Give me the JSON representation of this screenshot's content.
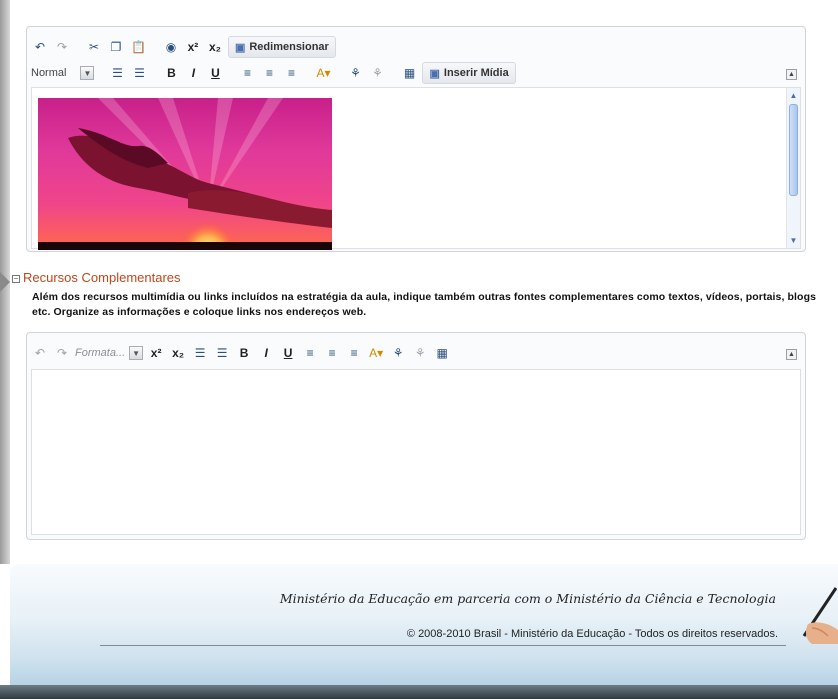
{
  "editor_top": {
    "toolbar_row1": {
      "resize_label": "Redimensionar"
    },
    "toolbar_row2": {
      "format_value": "Normal",
      "bold": "B",
      "italic": "I",
      "underline": "U",
      "insert_media_label": "Inserir Mídia"
    }
  },
  "section": {
    "title": "Recursos Complementares",
    "description": "Além dos recursos multimídia ou links incluídos na estratégia da aula, indique também outras fontes complementares como textos, vídeos, portais, blogs etc. Organize as informações e coloque links nos endereços web."
  },
  "editor_bottom": {
    "toolbar": {
      "format_placeholder": "Formata...",
      "bold": "B",
      "italic": "I",
      "underline": "U"
    }
  },
  "footer": {
    "tagline": "Ministério da Educação em parceria com o Ministério da Ciência e Tecnologia",
    "copyright": "© 2008-2010 Brasil - Ministério da Educação - Todos os direitos reservados."
  },
  "colors": {
    "section_title": "#c0461a",
    "toolbar_icon": "#2a4f7e",
    "scroll_thumb": "#a9c6ee"
  }
}
